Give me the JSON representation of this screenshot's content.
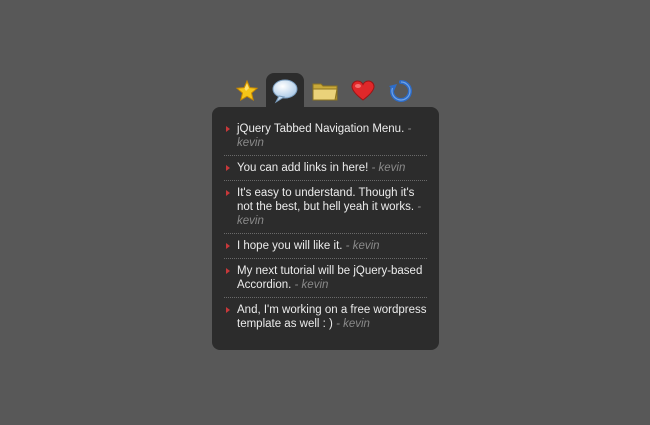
{
  "tabs": [
    {
      "icon": "star-icon",
      "name": "tab-favorites",
      "active": false,
      "color": "#f5c518"
    },
    {
      "icon": "speech-bubble-icon",
      "name": "tab-comments",
      "active": true,
      "color": "#cfe4f7"
    },
    {
      "icon": "folder-icon",
      "name": "tab-folders",
      "active": false,
      "color": "#e8d27a"
    },
    {
      "icon": "heart-icon",
      "name": "tab-favorites-heart",
      "active": false,
      "color": "#e0282a"
    },
    {
      "icon": "refresh-icon",
      "name": "tab-refresh",
      "active": false,
      "color": "#3a7bd5"
    }
  ],
  "colors": {
    "page_background": "#585858",
    "panel_background": "#2c2c2c",
    "bullet": "#c8383a",
    "text": "#ececec",
    "author": "#8a8a8a"
  },
  "comments": [
    {
      "text": "jQuery Tabbed Navigation Menu.",
      "author": "- kevin"
    },
    {
      "text": "You can add links in here!",
      "author": "- kevin"
    },
    {
      "text": "It's easy to understand. Though it's not the best, but hell yeah it works.",
      "author": "- kevin"
    },
    {
      "text": "I hope you will like it.",
      "author": "- kevin"
    },
    {
      "text": "My next tutorial will be jQuery-based Accordion.",
      "author": "- kevin"
    },
    {
      "text": "And, I'm working on a free wordpress template as well : )",
      "author": "- kevin"
    }
  ]
}
